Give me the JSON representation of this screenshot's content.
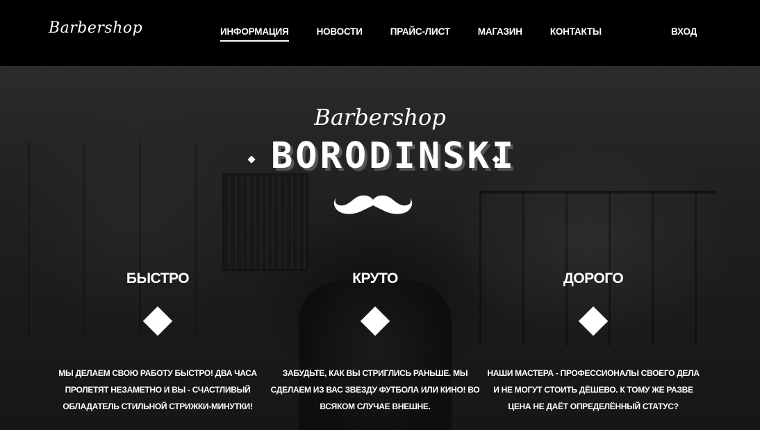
{
  "header": {
    "logo": "Barbershop",
    "nav": [
      "ИНФОРМАЦИЯ",
      "НОВОСТИ",
      "ПРАЙС-ЛИСТ",
      "МАГАЗИН",
      "КОНТАКТЫ"
    ],
    "active_nav": "ИНФОРМАЦИЯ",
    "login": "ВХОД"
  },
  "hero": {
    "script": "Barbershop",
    "title": "BORODINSKI"
  },
  "features": [
    {
      "title": "БЫСТРО",
      "text": "МЫ ДЕЛАЕМ СВОЮ РАБОТУ БЫСТРО! ДВА ЧАСА ПРОЛЕТЯТ НЕЗАМЕТНО И ВЫ - СЧАСТЛИВЫЙ ОБЛАДАТЕЛЬ СТИЛЬНОЙ СТРИЖКИ-МИНУТКИ!"
    },
    {
      "title": "КРУТО",
      "text": "ЗАБУДЬТЕ, КАК ВЫ СТРИГЛИСЬ РАНЬШЕ. МЫ СДЕЛАЕМ ИЗ ВАС ЗВЕЗДУ ФУТБОЛА ИЛИ КИНО! ВО ВСЯКОМ СЛУЧАЕ ВНЕШНЕ."
    },
    {
      "title": "ДОРОГО",
      "text": "НАШИ МАСТЕРА - ПРОФЕССИОНАЛЫ СВОЕГО ДЕЛА И НЕ МОГУТ СТОИТЬ ДЁШЕВО. К ТОМУ ЖЕ РАЗВЕ ЦЕНА НЕ ДАЁТ ОПРЕДЕЛЁННЫЙ СТАТУС?"
    }
  ],
  "colors": {
    "header_bg": "#000000",
    "text": "#ffffff"
  },
  "icons": [
    "mustache-icon",
    "diamond-icon"
  ]
}
